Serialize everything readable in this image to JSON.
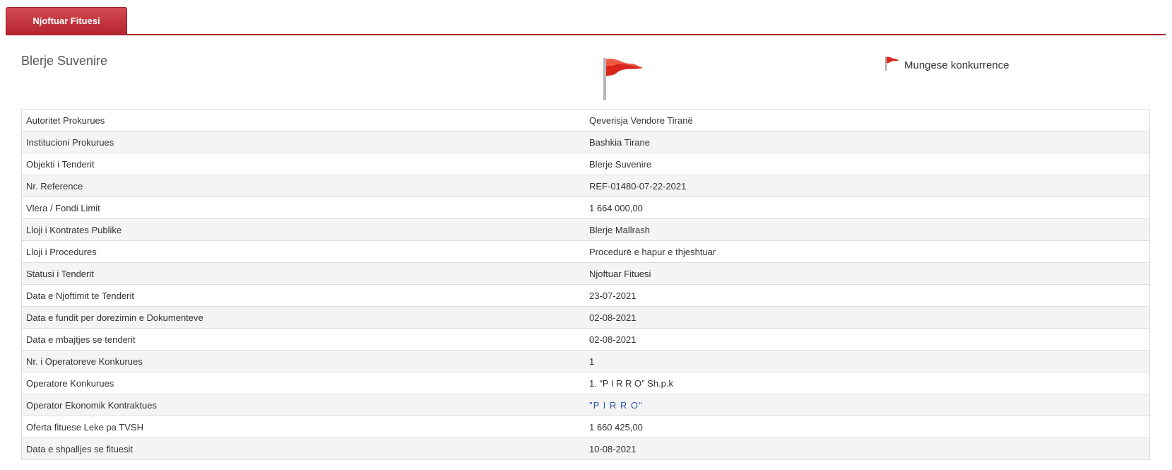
{
  "tabs": [
    {
      "label": "Njoftuar Fituesi",
      "active": true
    }
  ],
  "colors": {
    "accent": "#b52630",
    "flag": "#d9261c",
    "link": "#2a5aa8"
  },
  "title": "Blerje Suvenire",
  "legend": {
    "icon": "red-flag-icon",
    "label": "Mungese konkurrence"
  },
  "details": [
    {
      "label": "Autoritet Prokurues",
      "value": "Qeverisja Vendore Tiranë"
    },
    {
      "label": "Institucioni Prokurues",
      "value": "Bashkia Tirane"
    },
    {
      "label": "Objekti i Tenderit",
      "value": "Blerje Suvenire"
    },
    {
      "label": "Nr. Reference",
      "value": "REF-01480-07-22-2021"
    },
    {
      "label": "Vlera / Fondi Limit",
      "value": "1 664 000,00"
    },
    {
      "label": "Lloji i Kontrates Publike",
      "value": "Blerje Mallrash"
    },
    {
      "label": "Lloji i Procedures",
      "value": "Procedurë e hapur e thjeshtuar"
    },
    {
      "label": "Statusi i Tenderit",
      "value": "Njoftuar Fituesi"
    },
    {
      "label": "Data e Njoftimit te Tenderit",
      "value": "23-07-2021"
    },
    {
      "label": "Data e fundit per dorezimin e Dokumenteve",
      "value": "02-08-2021"
    },
    {
      "label": "Data e mbajtjes se tenderit",
      "value": "02-08-2021"
    },
    {
      "label": "Nr. i Operatoreve Konkurues",
      "value": "1"
    },
    {
      "label": "Operatore Konkurues",
      "value": "1. “P I R R O” Sh.p.k"
    },
    {
      "label": "Operator Ekonomik Kontraktues",
      "value": "\"P I R R O\"",
      "link": true
    },
    {
      "label": "Oferta fituese Leke pa TVSH",
      "value": "1 660 425,00"
    },
    {
      "label": "Data e shpalljes se fituesit",
      "value": "10-08-2021"
    }
  ]
}
